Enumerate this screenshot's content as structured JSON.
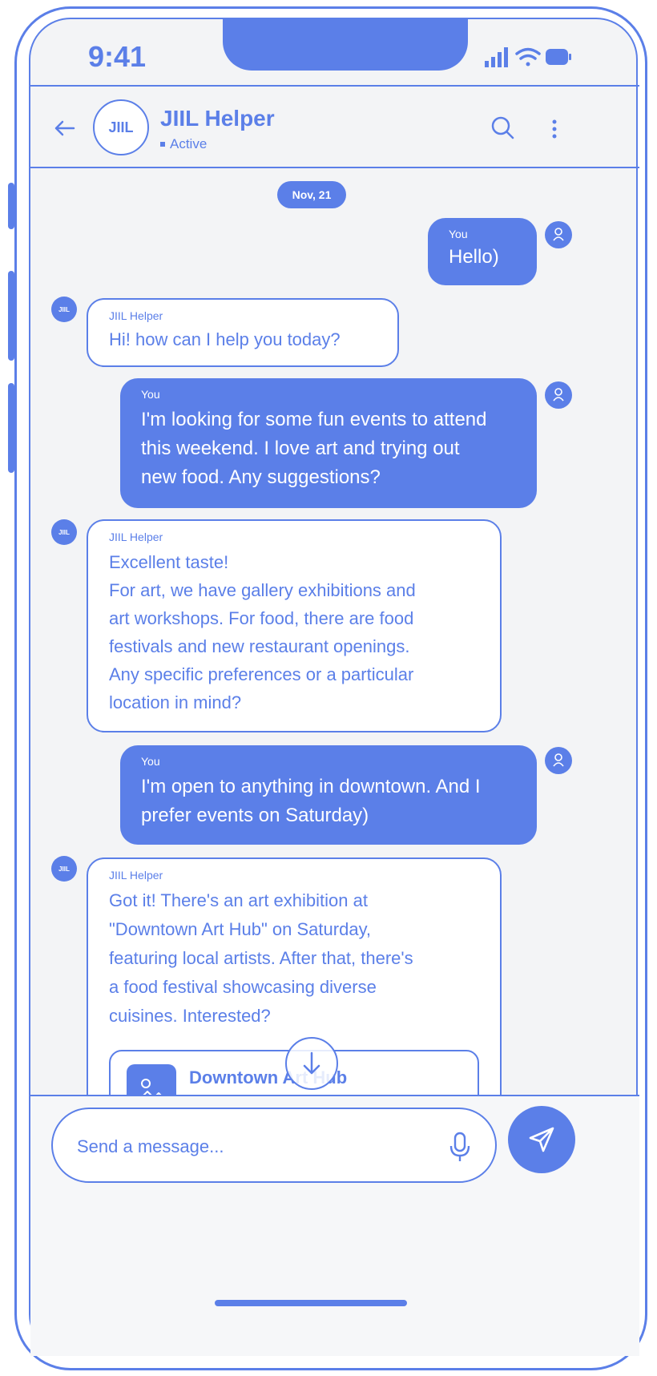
{
  "status_bar": {
    "time": "9:41",
    "icons": [
      "signal-icon",
      "wifi-icon",
      "battery-icon"
    ]
  },
  "header": {
    "back_icon": "arrow-left-icon",
    "avatar_text": "JIIL",
    "title": "JIIL Helper",
    "status": "Active",
    "search_icon": "search-icon",
    "menu_icon": "more-vertical-icon"
  },
  "date_chip": "Nov, 21",
  "messages": [
    {
      "from": "me",
      "sender": "You",
      "text": "Hello)"
    },
    {
      "from": "bot",
      "sender": "JIIL Helper",
      "text": "Hi! how can I help you today?"
    },
    {
      "from": "me",
      "sender": "You",
      "text": "I'm looking for some fun events to attend\nthis weekend. I love art and trying out\nnew food. Any suggestions?"
    },
    {
      "from": "bot",
      "sender": "JIIL Helper",
      "text": "Excellent taste!\nFor art, we have gallery exhibitions and\nart workshops. For food, there are food\nfestivals and new restaurant openings.\nAny specific preferences or a particular\nlocation in mind?"
    },
    {
      "from": "me",
      "sender": "You",
      "text": "I'm open to anything in downtown. And I\nprefer events on Saturday)"
    },
    {
      "from": "bot",
      "sender": "JIIL Helper",
      "text": "Got it! There's an art exhibition at\n\"Downtown Art Hub\" on Saturday,\nfeaturing local artists. After that, there's\na food festival showcasing diverse\ncuisines. Interested?"
    }
  ],
  "bot_avatar_text": "JIIL",
  "event_card": {
    "title": "Downtown Art Hub",
    "icon": "image-icon"
  },
  "composer": {
    "placeholder": "Send a message...",
    "mic_icon": "microphone-icon",
    "send_icon": "send-icon",
    "scroll_icon": "arrow-down-icon"
  },
  "colors": {
    "accent": "#5b7fe8",
    "background": "#f3f4f6",
    "bubble_bot": "#ffffff"
  }
}
